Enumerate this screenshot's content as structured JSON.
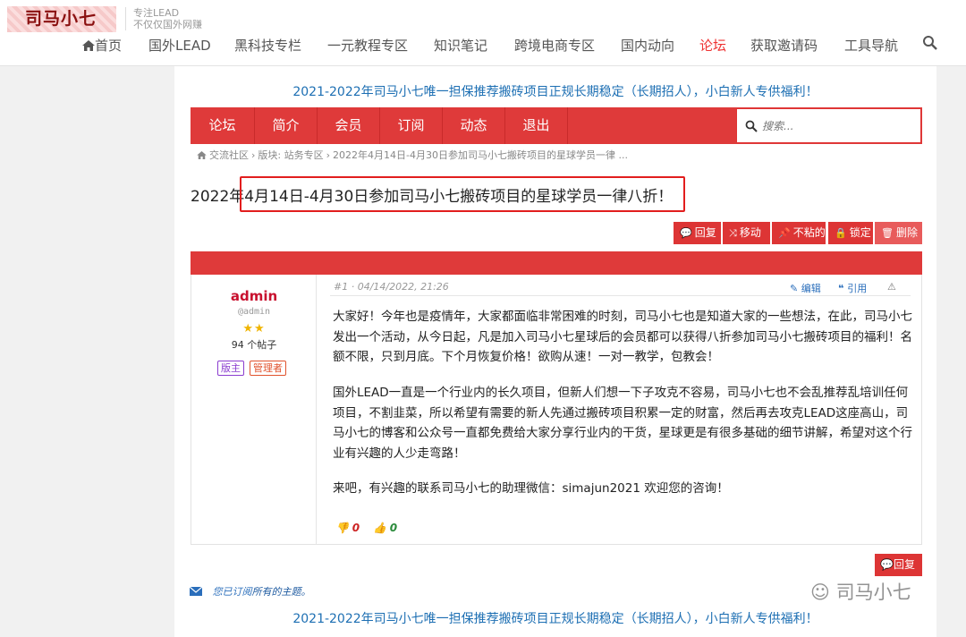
{
  "site": {
    "logo": "司马小七",
    "slogan_line1": "专注LEAD",
    "slogan_line2": "不仅仅国外网赚"
  },
  "nav": {
    "items": [
      "首页",
      "国外LEAD",
      "黑科技专栏",
      "一元教程专区",
      "知识笔记",
      "跨境电商专区",
      "国内动向",
      "论坛",
      "获取邀请码",
      "工具导航"
    ],
    "active": "论坛",
    "search_icon": "search-icon",
    "home_icon": "home-icon"
  },
  "notice": "2021-2022年司马小七唯一担保推荐搬砖项目正规长期稳定（长期招人），小白新人专供福利！",
  "forum_bar": {
    "items": [
      "论坛",
      "简介",
      "会员",
      "订阅",
      "动态",
      "退出"
    ],
    "search_placeholder": "搜索..."
  },
  "breadcrumb": [
    "交流社区",
    "版块: 站务专区",
    "2022年4月14日-4月30日参加司马小七搬砖项目的星球学员一律 ..."
  ],
  "topic_title": "2022年4月14日-4月30日参加司马小七搬砖项目的星球学员一律八折！",
  "actions": [
    "回复",
    "移动",
    "不粘的",
    "锁定",
    "删除"
  ],
  "post": {
    "author": "admin",
    "handle": "@admin",
    "stars": "★★",
    "post_count": "94 个帖子",
    "badges": [
      "版主",
      "管理者"
    ],
    "meta": "#1 · 04/14/2022, 21:26",
    "tools": [
      "编辑",
      "引用"
    ],
    "paragraphs": [
      "大家好！今年也是疫情年，大家都面临非常困难的时刻，司马小七也是知道大家的一些想法，在此，司马小七发出一个活动，从今日起，凡是加入司马小七星球后的会员都可以获得八折参加司马小七搬砖项目的福利！名额不限，只到月底。下个月恢复价格！欲购从速！一对一教学，包教会！",
      "国外LEAD一直是一个行业内的长久项目，但新人们想一下子攻克不容易，司马小七也不会乱推荐乱培训任何项目，不割韭菜，所以希望有需要的新人先通过搬砖项目积累一定的财富，然后再去攻克LEAD这座高山，司马小七的博客和公众号一直都免费给大家分享行业内的干货，星球更是有很多基础的细节讲解，希望对这个行业有兴趣的人少走弯路！",
      "来吧，有兴趣的联系司马小七的助理微信：simajun2021  欢迎您的咨询！"
    ],
    "downvotes": "0",
    "upvotes": "0"
  },
  "reply_button": "回复",
  "subscription": {
    "prefix": "您已订阅",
    "link": "所有的主题。"
  },
  "watermark": "司马小七",
  "colors": {
    "accent": "#df3a3a",
    "link": "#1d6fb3",
    "highlight": "#e21e1e"
  }
}
